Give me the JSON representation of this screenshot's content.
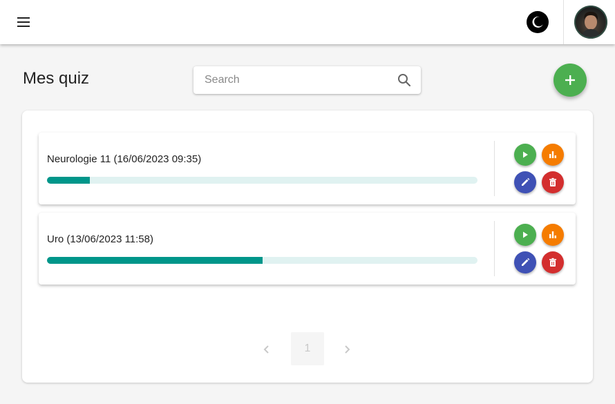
{
  "topbar": {
    "menu_icon": "menu-icon",
    "theme_icon": "moon-icon",
    "avatar_icon": "user-avatar"
  },
  "page": {
    "title": "Mes quiz"
  },
  "search": {
    "placeholder": "Search",
    "value": "",
    "icon": "search-icon"
  },
  "add_button": {
    "icon": "plus-icon",
    "color": "#4caf50"
  },
  "quizzes": [
    {
      "title": "Neurologie 11 (16/06/2023 09:35)",
      "progress": 0.1
    },
    {
      "title": "Uro (13/06/2023 11:58)",
      "progress": 0.5
    }
  ],
  "actions": {
    "play": {
      "icon": "play-icon",
      "color": "#4caf50"
    },
    "stats": {
      "icon": "bar-chart-icon",
      "color": "#f57c00"
    },
    "edit": {
      "icon": "pencil-icon",
      "color": "#3f51b5"
    },
    "delete": {
      "icon": "trash-icon",
      "color": "#d32f2f"
    }
  },
  "progress_colors": {
    "fill": "#00968a",
    "track": "#e0f2f1"
  },
  "pagination": {
    "current_page": "1",
    "prev_icon": "chevron-left-icon",
    "next_icon": "chevron-right-icon"
  }
}
